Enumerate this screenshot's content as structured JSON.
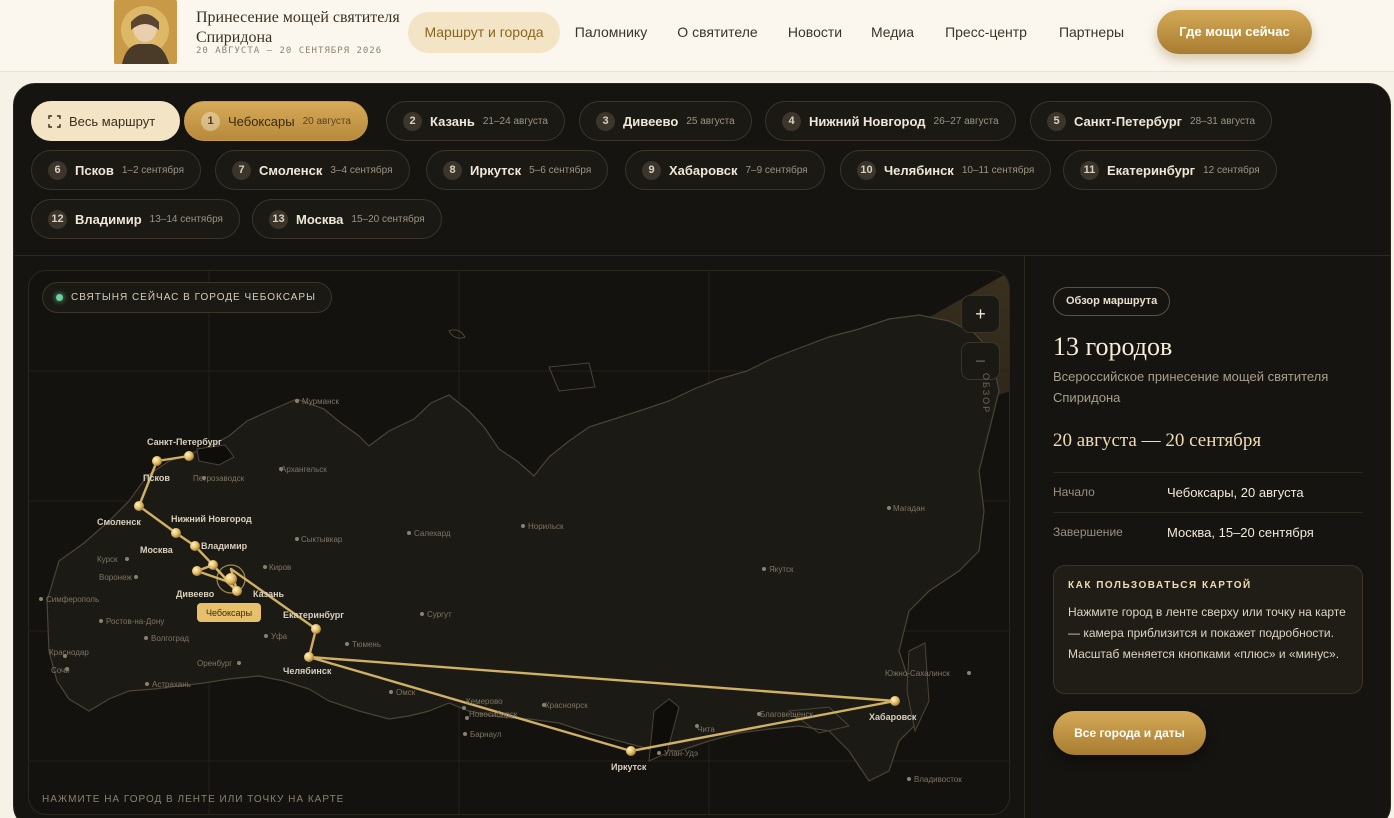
{
  "header": {
    "logo_title": "Принесение мощей святителя Спиридона",
    "logo_dates": "20 АВГУСТА — 20 СЕНТЯБРЯ 2026",
    "nav": [
      {
        "label": "Маршрут и города"
      },
      {
        "label": "Паломнику"
      },
      {
        "label": "О святителе"
      },
      {
        "label": "Новости"
      },
      {
        "label": "Медиа"
      },
      {
        "label": "Пресс-центр"
      },
      {
        "label": "Партнеры"
      }
    ],
    "cta_label": "Где мощи сейчас"
  },
  "chips": {
    "all_label": "Весь маршрут",
    "cities": [
      {
        "num": "1",
        "city": "Чебоксары",
        "date": "20 августа",
        "active": true
      },
      {
        "num": "2",
        "city": "Казань",
        "date": "21–24 августа"
      },
      {
        "num": "3",
        "city": "Дивеево",
        "date": "25 августа"
      },
      {
        "num": "4",
        "city": "Нижний Новгород",
        "date": "26–27 августа"
      },
      {
        "num": "5",
        "city": "Санкт-Петербург",
        "date": "28–31 августа"
      },
      {
        "num": "6",
        "city": "Псков",
        "date": "1–2 сентября"
      },
      {
        "num": "7",
        "city": "Смоленск",
        "date": "3–4 сентября"
      },
      {
        "num": "8",
        "city": "Иркутск",
        "date": "5–6 сентября"
      },
      {
        "num": "9",
        "city": "Хабаровск",
        "date": "7–9 сентября"
      },
      {
        "num": "10",
        "city": "Челябинск",
        "date": "10–11 сентября"
      },
      {
        "num": "11",
        "city": "Екатеринбург",
        "date": "12 сентября"
      },
      {
        "num": "12",
        "city": "Владимир",
        "date": "13–14 сентября"
      },
      {
        "num": "13",
        "city": "Москва",
        "date": "15–20 сентября"
      }
    ]
  },
  "map": {
    "status": "Святыня сейчас в городе Чебоксары",
    "zoom_in": "+",
    "zoom_out": "−",
    "vertical_label": "ОБЗОР",
    "hint": "Нажмите на город в ленте или точку на карте",
    "tooltip": "Чебоксары",
    "route_cities": [
      "Санкт-Петербург",
      "Псков",
      "Смоленск",
      "Нижний Новгород",
      "Москва",
      "Владимир",
      "Дивеево",
      "Казань",
      "Екатеринбург",
      "Челябинск",
      "Иркутск",
      "Хабаровск"
    ],
    "other_cities": [
      "Мурманск",
      "Петрозаводск",
      "Архангельск",
      "Сыктывкар",
      "Салехард",
      "Норильск",
      "Магадан",
      "Якутск",
      "Курск",
      "Воронеж",
      "Киров",
      "Симферополь",
      "Ростов-на-Дону",
      "Волгоград",
      "Краснодар",
      "Сочи",
      "Оренбург",
      "Уфа",
      "Тюмень",
      "Сургут",
      "Астрахань",
      "Омск",
      "Кемерово",
      "Новосибирск",
      "Красноярск",
      "Барнаул",
      "Чита",
      "Улан-Удэ",
      "Благовещенск",
      "Южно-Сахалинск",
      "Владивосток"
    ],
    "accent": "#d9b868"
  },
  "side": {
    "badge": "Обзор маршрута",
    "title": "13 городов",
    "subtitle": "Всероссийское принесение мощей святителя Спиридона",
    "dates": "20 августа — 20 сентября",
    "start_key": "Начало",
    "start_val": "Чебоксары, 20 августа",
    "end_key": "Завершение",
    "end_val": "Москва, 15–20 сентября",
    "howto_title": "Как пользоваться картой",
    "howto_text": "Нажмите город в ленте сверху или точку на карте — камера приблизится и покажет подробности. Масштаб меняется кнопками «плюс» и «минус».",
    "all_button": "Все города и даты"
  }
}
